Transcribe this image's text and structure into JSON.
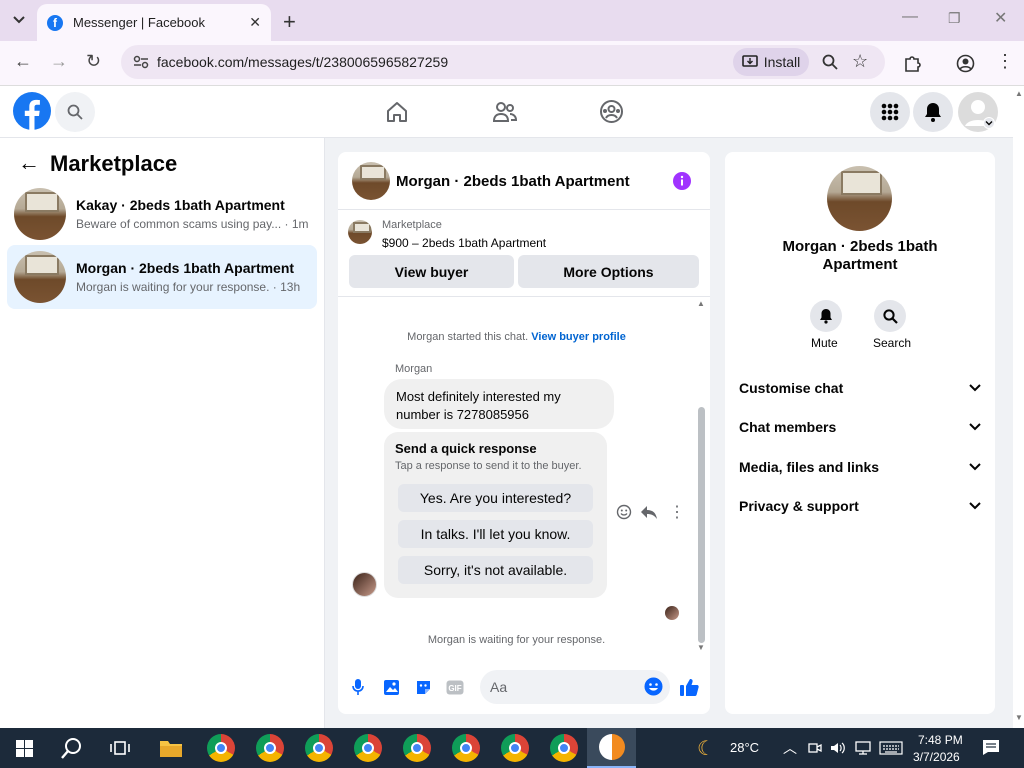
{
  "browser": {
    "tab_title": "Messenger | Facebook",
    "tab_favicon": "f",
    "url": "facebook.com/messages/t/2380065965827259",
    "install_label": "Install"
  },
  "left": {
    "back_label": "←",
    "title": "Marketplace",
    "conversations": [
      {
        "name": "Kakay · 2beds 1bath Apartment",
        "preview": "Beware of common scams using pay...",
        "time": "· 1m"
      },
      {
        "name": "Morgan · 2beds 1bath Apartment",
        "preview": "Morgan is waiting for your response.",
        "time": "· 13h"
      }
    ]
  },
  "chat": {
    "title": "Morgan · 2beds 1bath Apartment",
    "listing": {
      "label": "Marketplace",
      "detail": "$900 – 2beds 1bath Apartment"
    },
    "view_buyer": "View buyer",
    "more_options": "More Options",
    "started_text": "Morgan started this chat.",
    "buyer_profile_link": "View buyer profile",
    "sender_name": "Morgan",
    "message": "Most definitely interested my number is 7278085956",
    "quick_title": "Send a quick response",
    "quick_sub": "Tap a response to send it to the buyer.",
    "quick_replies": [
      "Yes. Are you interested?",
      "In talks. I'll let you know.",
      "Sorry, it's not available."
    ],
    "waiting": "Morgan is waiting for your response.",
    "input_placeholder": "Aa"
  },
  "info": {
    "name": "Morgan · 2beds 1bath Apartment",
    "mute_label": "Mute",
    "search_label": "Search",
    "sections": [
      "Customise chat",
      "Chat members",
      "Media, files and links",
      "Privacy & support"
    ]
  },
  "taskbar": {
    "temperature": "28°C",
    "time": "7:48 PM",
    "date": "3/7/2026"
  },
  "colors": {
    "fb_blue": "#1877f2",
    "accent_purple": "#a033ff",
    "taskbar": "#1c2a3a"
  }
}
